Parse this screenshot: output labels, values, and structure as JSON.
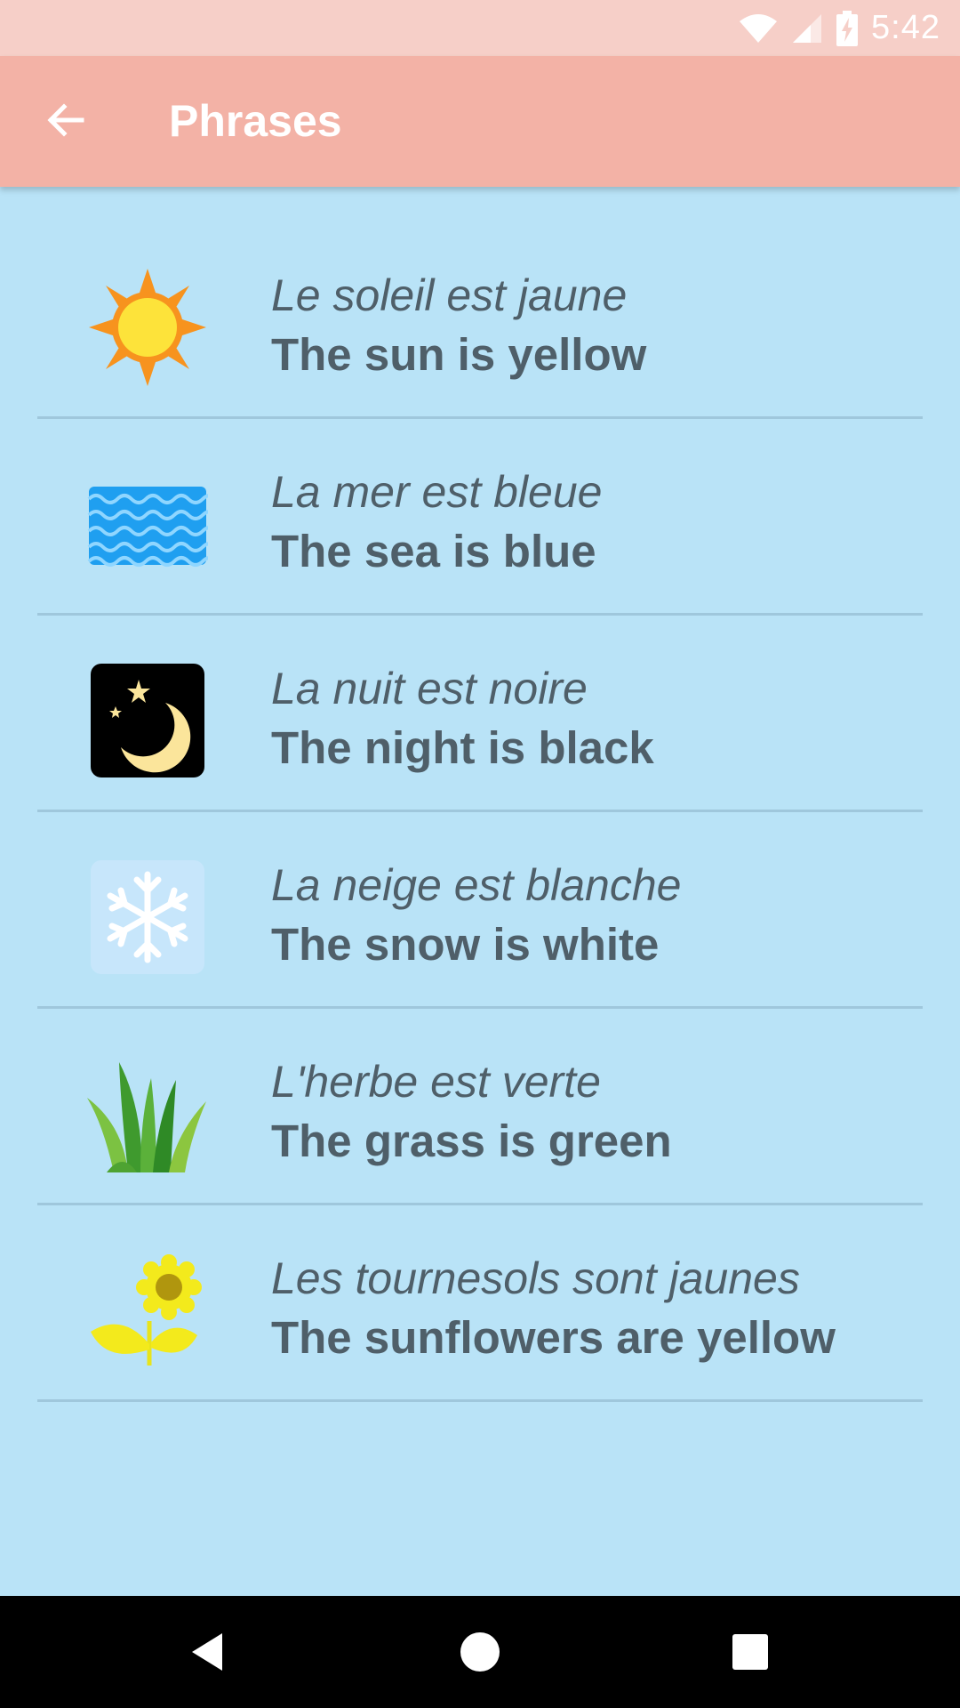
{
  "status_bar": {
    "time": "5:42",
    "icons": [
      "wifi-icon",
      "cell-signal-icon",
      "battery-charging-icon"
    ]
  },
  "app_bar": {
    "back_icon": "arrow-back-icon",
    "title": "Phrases"
  },
  "phrases": [
    {
      "icon": "sun-icon",
      "french": "Le soleil est jaune",
      "english": "The sun is yellow"
    },
    {
      "icon": "water-waves-icon",
      "french": "La mer est bleue",
      "english": "The sea is blue"
    },
    {
      "icon": "night-moon-icon",
      "french": "La nuit est noire",
      "english": "The night is black"
    },
    {
      "icon": "snowflake-icon",
      "french": "La neige est blanche",
      "english": "The snow is white"
    },
    {
      "icon": "grass-icon",
      "french": "L'herbe est verte",
      "english": "The grass is green"
    },
    {
      "icon": "sunflower-icon",
      "french": "Les tournesols sont jaunes",
      "english": "The sunflowers are yellow"
    }
  ],
  "nav_bar": {
    "back": "nav-back-icon",
    "home": "nav-home-icon",
    "recents": "nav-recents-icon"
  },
  "colors": {
    "status_bar": "#f6cfc8",
    "app_bar": "#f3b2a6",
    "background": "#b9e3f7",
    "text": "#4f5f69",
    "divider": "#9fc7dc"
  }
}
